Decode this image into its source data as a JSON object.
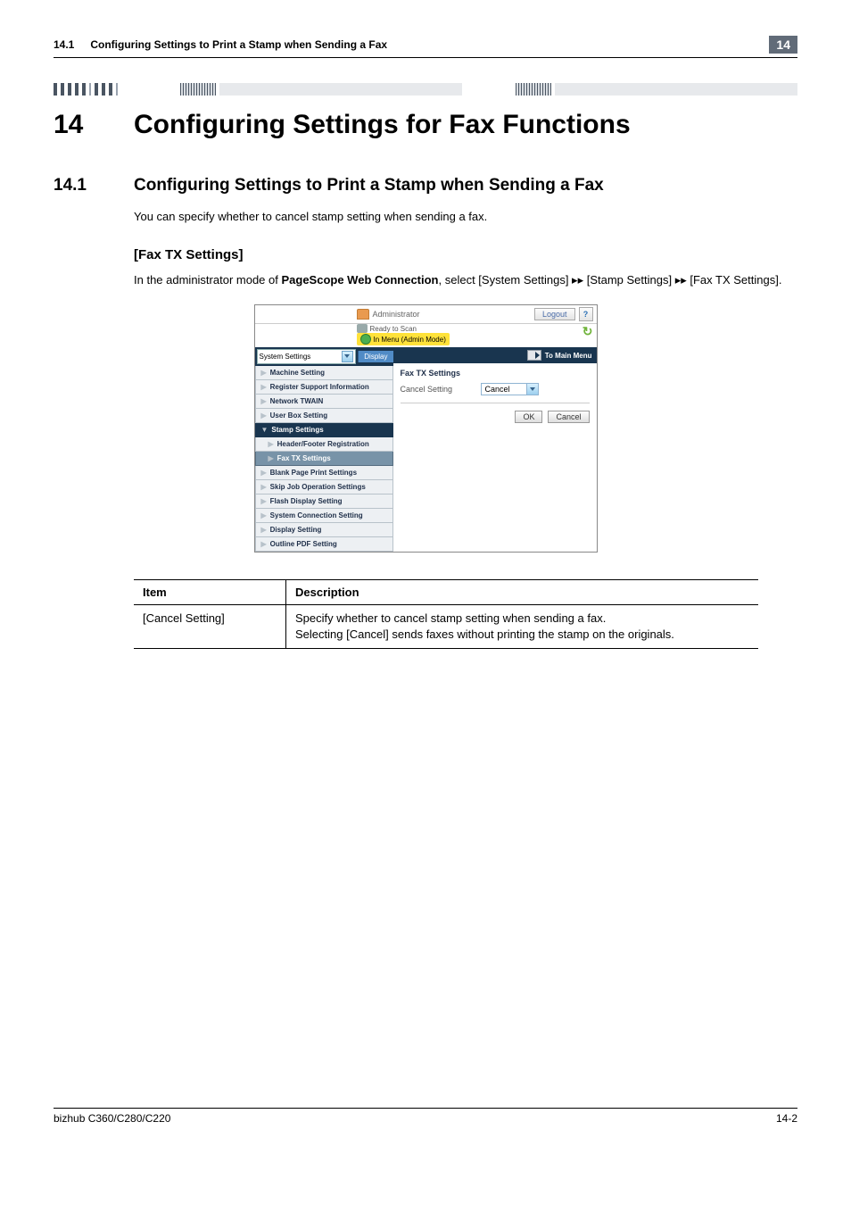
{
  "running_head": {
    "section_number": "14.1",
    "section_title": "Configuring Settings to Print a Stamp when Sending a Fax",
    "chapter_number": "14"
  },
  "chapter": {
    "number": "14",
    "title": "Configuring Settings for Fax Functions"
  },
  "section": {
    "number": "14.1",
    "title": "Configuring Settings to Print a Stamp when Sending a Fax",
    "intro": "You can specify whether to cancel stamp setting when sending a fax."
  },
  "subsection": {
    "title": "[Fax TX Settings]",
    "body_a": "In the administrator mode of ",
    "body_bold": "PageScope Web Connection",
    "body_b": ", select [System Settings] ▸▸ [Stamp Settings] ▸▸ [Fax TX Settings]."
  },
  "app_shot": {
    "header": {
      "admin_label": "Administrator",
      "logout": "Logout",
      "help": "?"
    },
    "status": {
      "ready": "Ready to Scan",
      "mode": "In Menu (Admin Mode)"
    },
    "left_nav": {
      "selector_value": "System Settings",
      "display_button": "Display",
      "items": [
        {
          "label": "Machine Setting",
          "kind": "plain"
        },
        {
          "label": "Register Support Information",
          "kind": "plain"
        },
        {
          "label": "Network TWAIN",
          "kind": "plain"
        },
        {
          "label": "User Box Setting",
          "kind": "plain"
        },
        {
          "label": "Stamp Settings",
          "kind": "expanded"
        },
        {
          "label": "Header/Footer Registration",
          "kind": "indent"
        },
        {
          "label": "Fax TX Settings",
          "kind": "current"
        },
        {
          "label": "Blank Page Print Settings",
          "kind": "plain"
        },
        {
          "label": "Skip Job Operation Settings",
          "kind": "plain"
        },
        {
          "label": "Flash Display Setting",
          "kind": "plain"
        },
        {
          "label": "System Connection Setting",
          "kind": "plain"
        },
        {
          "label": "Display Setting",
          "kind": "plain"
        },
        {
          "label": "Outline PDF Setting",
          "kind": "plain"
        }
      ]
    },
    "main_pane": {
      "to_main_menu": "To Main Menu",
      "form_title": "Fax TX Settings",
      "row_label": "Cancel Setting",
      "row_value": "Cancel",
      "ok": "OK",
      "cancel": "Cancel"
    }
  },
  "table": {
    "head_item": "Item",
    "head_desc": "Description",
    "row_item": "[Cancel Setting]",
    "row_desc_line1": "Specify whether to cancel stamp setting when sending a fax.",
    "row_desc_line2": "Selecting [Cancel] sends faxes without printing the stamp on the originals."
  },
  "footer": {
    "model": "bizhub C360/C280/C220",
    "page": "14-2"
  }
}
